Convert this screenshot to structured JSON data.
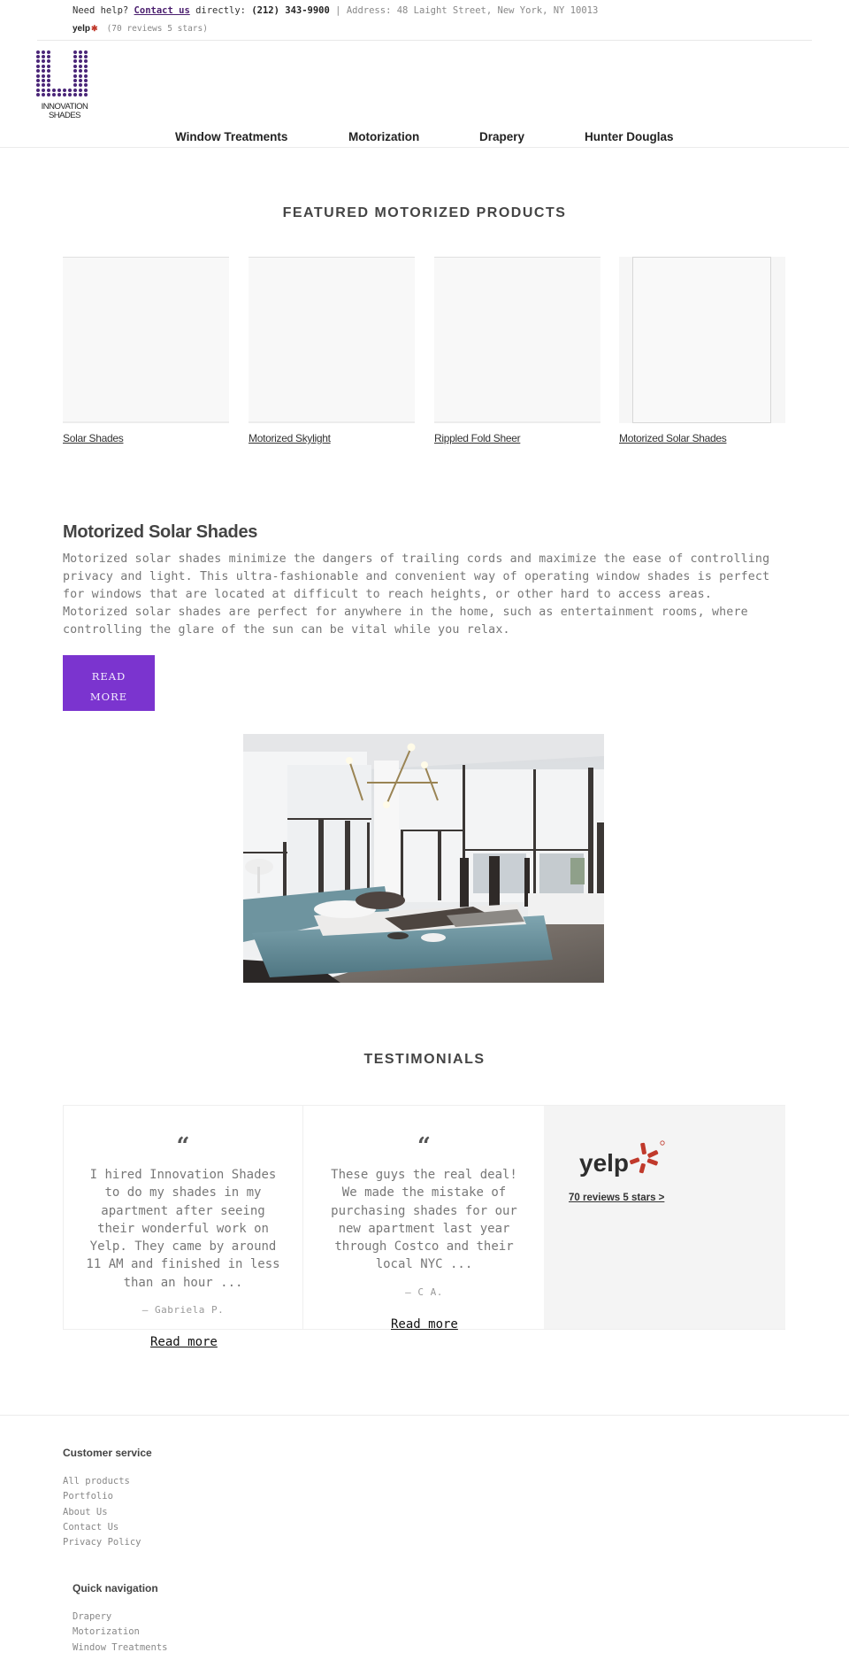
{
  "topbar": {
    "need_help": "Need help?",
    "contact_link": "Contact us",
    "directly": "directly:",
    "phone": "(212) 343-9900",
    "separator": "|",
    "address": "Address: 48 Laight Street, New York, NY 10013",
    "yelp_label": "yelp",
    "yelp_reviews": "(70 reviews 5 stars)"
  },
  "logo": {
    "line1": "INNOVATION",
    "line2": "SHADES",
    "color": "#4a2578"
  },
  "nav": {
    "items": [
      {
        "label": "Window Treatments"
      },
      {
        "label": "Motorization"
      },
      {
        "label": "Drapery"
      },
      {
        "label": "Hunter Douglas"
      }
    ]
  },
  "featured": {
    "title": "FEATURED MOTORIZED PRODUCTS",
    "products": [
      {
        "name": "Solar Shades"
      },
      {
        "name": "Motorized Skylight"
      },
      {
        "name": "Rippled Fold Sheer"
      },
      {
        "name": "Motorized Solar Shades"
      }
    ]
  },
  "article": {
    "title": "Motorized Solar Shades",
    "body": "Motorized solar shades minimize the dangers of trailing cords and maximize the ease of controlling privacy and light. This ultra-fashionable and convenient way of operating window shades is perfect for windows that are located at difficult to reach heights, or other hard to access areas. Motorized solar shades are perfect for anywhere in the home, such as entertainment rooms, where controlling the glare of the sun can be vital while you relax.",
    "button_line1": "READ",
    "button_line2": "MORE",
    "button_color": "#7b34cf",
    "image_icon": "bedroom-photo"
  },
  "testimonials": {
    "title": "TESTIMONIALS",
    "quote_glyph": "“",
    "items": [
      {
        "text": "I hired Innovation Shades to do my shades in my apartment after seeing their wonderful work on Yelp. They came by around 11 AM and finished in less than an hour ...",
        "author": "— Gabriela P.",
        "read_more": "Read more"
      },
      {
        "text": "These guys the real deal! We made the mistake of purchasing shades for our new apartment last year through Costco and their local NYC  ...",
        "author": "— C A.",
        "read_more": "Read more"
      }
    ],
    "yelp": {
      "logo_text": "yelp",
      "link": "70 reviews 5 stars >",
      "brand_color": "#c0392b"
    }
  },
  "footer": {
    "customer_service": {
      "heading": "Customer service",
      "links": [
        "All products",
        "Portfolio",
        "About Us",
        "Contact Us",
        "Privacy Policy"
      ]
    },
    "quick_navigation": {
      "heading": "Quick navigation",
      "links": [
        "Drapery",
        "Motorization",
        "Window Treatments"
      ]
    }
  }
}
